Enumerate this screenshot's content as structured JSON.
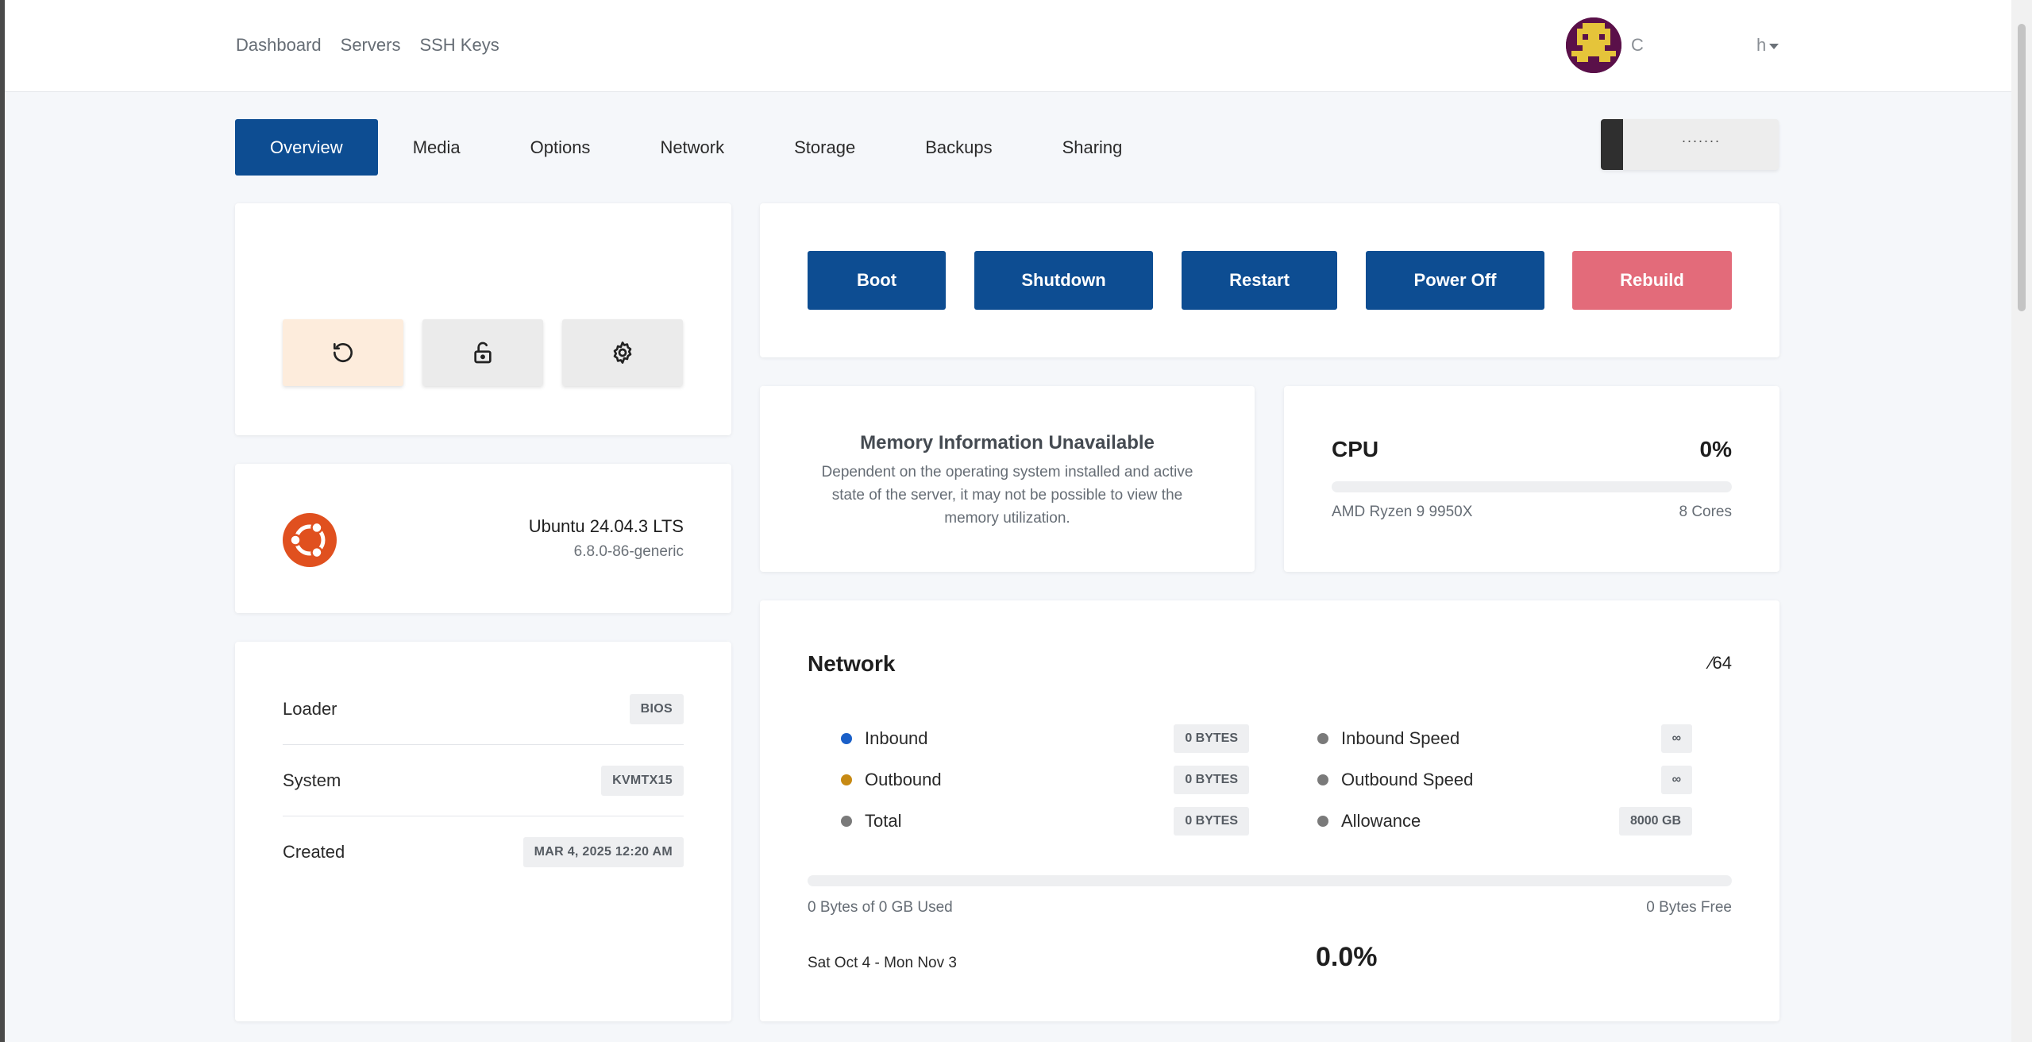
{
  "nav": {
    "links": [
      "Dashboard",
      "Servers",
      "SSH Keys"
    ],
    "user_name": "C",
    "user_menu_label": "h"
  },
  "tabs": {
    "items": [
      "Overview",
      "Media",
      "Options",
      "Network",
      "Storage",
      "Backups",
      "Sharing"
    ],
    "active": "Overview",
    "search_value": "·······"
  },
  "quick_actions": {
    "icons": [
      "refresh-icon",
      "unlock-icon",
      "gear-icon"
    ]
  },
  "os": {
    "name": "Ubuntu 24.04.3 LTS",
    "kernel": "6.8.0-86-generic",
    "logo_color": "#e0501f"
  },
  "info": {
    "rows": [
      {
        "label": "Loader",
        "value": "BIOS"
      },
      {
        "label": "System",
        "value": "KVMTX15"
      },
      {
        "label": "Created",
        "value": "MAR 4, 2025 12:20 AM"
      }
    ]
  },
  "power": {
    "buttons": [
      "Boot",
      "Shutdown",
      "Restart",
      "Power Off",
      "Rebuild"
    ]
  },
  "memory": {
    "title": "Memory Information Unavailable",
    "description": "Dependent on the operating system installed and active state of the server, it may not be possible to view the memory utilization."
  },
  "cpu": {
    "title": "CPU",
    "percent_label": "0%",
    "usage_fraction": 0.0,
    "model": "AMD Ryzen 9 9950X",
    "cores": "8 Cores"
  },
  "network": {
    "title": "Network",
    "corner_text": "⁄64",
    "stats": [
      {
        "label": "Inbound",
        "value": "0 BYTES",
        "dot_color": "#1a5fc8"
      },
      {
        "label": "Outbound",
        "value": "0 BYTES",
        "dot_color": "#c78a14"
      },
      {
        "label": "Total",
        "value": "0 BYTES",
        "dot_color": "#7a7a7a"
      },
      {
        "label": "Inbound Speed",
        "value": "∞",
        "dot_color": "#7a7a7a"
      },
      {
        "label": "Outbound Speed",
        "value": "∞",
        "dot_color": "#7a7a7a"
      },
      {
        "label": "Allowance",
        "value": "8000 GB",
        "dot_color": "#7a7a7a"
      }
    ],
    "usage_fraction": 0.0,
    "used_text": "0 Bytes of 0 GB Used",
    "free_text": "0 Bytes Free",
    "period": "Sat Oct 4 - Mon Nov 3",
    "period_percent": "0.0%"
  },
  "colors": {
    "primary": "#0d4d92",
    "danger": "#e36b7a",
    "refresh_bg": "#fdecdc",
    "neutral_bg": "#ebebeb"
  }
}
